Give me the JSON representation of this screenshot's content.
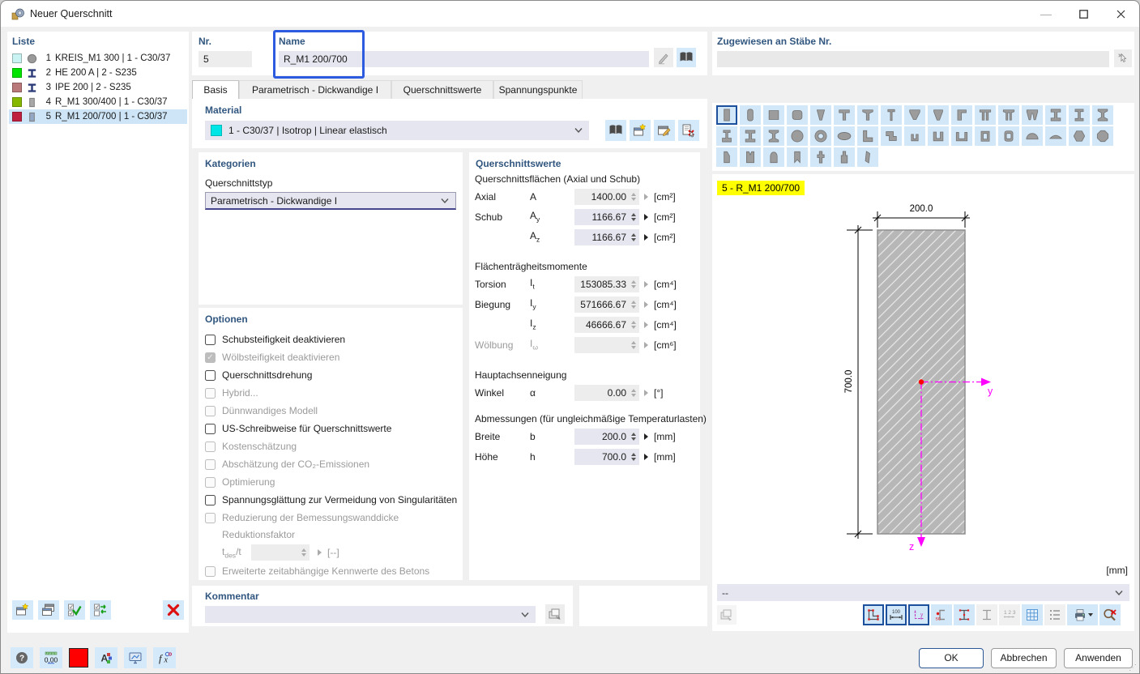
{
  "window": {
    "title": "Neuer Querschnitt"
  },
  "liste": {
    "header": "Liste",
    "items": [
      {
        "nr": "1",
        "label": "KREIS_M1 300 | 1 - C30/37",
        "color": "#c9f2f2",
        "shape": "circle",
        "shape_color": "#9a9a9a",
        "selected": false
      },
      {
        "nr": "2",
        "label": "HE 200 A | 2 - S235",
        "color": "#00e400",
        "shape": "ibeam",
        "shape_color": "#2a3a77",
        "selected": false
      },
      {
        "nr": "3",
        "label": "IPE 200 | 2 - S235",
        "color": "#b9797a",
        "shape": "ibeam",
        "shape_color": "#2a3a77",
        "selected": false
      },
      {
        "nr": "4",
        "label": "R_M1 300/400 | 1 - C30/37",
        "color": "#86b800",
        "shape": "rect",
        "shape_color": "#a8a8a8",
        "selected": false
      },
      {
        "nr": "5",
        "label": "R_M1 200/700 | 1 - C30/37",
        "color": "#c0203f",
        "shape": "rect",
        "shape_color": "#93a7c4",
        "selected": true
      }
    ],
    "toolbar": [
      {
        "name": "new-section",
        "glyph": "newwin"
      },
      {
        "name": "copy-section",
        "glyph": "copywin"
      },
      {
        "name": "select-all-checks",
        "glyph": "checkall"
      },
      {
        "name": "invert-checks",
        "glyph": "invert"
      },
      {
        "name": "delete-section",
        "glyph": "delx",
        "push": true
      }
    ]
  },
  "header_fields": {
    "nr_label": "Nr.",
    "nr_value": "5",
    "name_label": "Name",
    "name_value": "R_M1 200/700"
  },
  "assigned": {
    "label": "Zugewiesen an Stäbe Nr.",
    "value": ""
  },
  "tabs": [
    {
      "label": "Basis",
      "active": true
    },
    {
      "label": "Parametrisch - Dickwandige I",
      "active": false
    },
    {
      "label": "Querschnittswerte",
      "active": false
    },
    {
      "label": "Spannungspunkte",
      "active": false
    }
  ],
  "material": {
    "header": "Material",
    "value": "1 - C30/37 | Isotrop | Linear elastisch",
    "swatch_color": "#00e6e6",
    "icons": [
      {
        "name": "material-library",
        "glyph": "book"
      },
      {
        "name": "material-new",
        "glyph": "newwin"
      },
      {
        "name": "material-edit",
        "glyph": "editwin"
      },
      {
        "name": "material-delete",
        "glyph": "deldoc"
      }
    ]
  },
  "kategorien": {
    "header": "Kategorien",
    "type_label": "Querschnittstyp",
    "type_value": "Parametrisch - Dickwandige I"
  },
  "optionen": {
    "header": "Optionen",
    "items": [
      {
        "id": "schubsteifigkeit",
        "label": "Schubsteifigkeit deaktivieren",
        "checked": false,
        "disabled": false
      },
      {
        "id": "woelbsteifigkeit",
        "label": "Wölbsteifigkeit deaktivieren",
        "checked": true,
        "disabled": true
      },
      {
        "id": "querschnittsdrehung",
        "label": "Querschnittsdrehung",
        "checked": false,
        "disabled": false
      },
      {
        "id": "hybrid",
        "label": "Hybrid...",
        "checked": false,
        "disabled": true
      },
      {
        "id": "duennwandiges-modell",
        "label": "Dünnwandiges Modell",
        "checked": false,
        "disabled": true
      },
      {
        "id": "us-schreibweise",
        "label": "US-Schreibweise für Querschnittswerte",
        "checked": false,
        "disabled": false
      },
      {
        "id": "kostenschaetzung",
        "label": "Kostenschätzung",
        "checked": false,
        "disabled": true
      },
      {
        "id": "co2-emissionen",
        "label": "Abschätzung der CO₂-Emissionen",
        "checked": false,
        "disabled": true
      },
      {
        "id": "optimierung",
        "label": "Optimierung",
        "checked": false,
        "disabled": true
      },
      {
        "id": "spannungsglaettung",
        "label": "Spannungsglättung zur Vermeidung von Singularitäten",
        "checked": false,
        "disabled": false
      },
      {
        "id": "reduzierung-wanddicke",
        "label": "Reduzierung der Bemessungswanddicke",
        "checked": false,
        "disabled": true
      },
      {
        "id": "erweiterte-kennwerte",
        "label": "Erweiterte zeitabhängige Kennwerte des Betons",
        "checked": false,
        "disabled": true
      }
    ],
    "reduktion": {
      "label": "Reduktionsfaktor",
      "sym": "t",
      "sym_sub": "des",
      "sym_rest": "/t",
      "value": "",
      "unit": "[--]"
    }
  },
  "werte": {
    "header": "Querschnittswerte",
    "groups": [
      {
        "title": "Querschnittsflächen (Axial und Schub)",
        "rows": [
          {
            "label": "Axial",
            "sym": "A",
            "sub": "",
            "value": "1400.00",
            "unit": "[cm²]",
            "enabled": false,
            "muted": false
          },
          {
            "label": "Schub",
            "sym": "A",
            "sub": "y",
            "value": "1166.67",
            "unit": "[cm²]",
            "enabled": true,
            "muted": false
          },
          {
            "label": "",
            "sym": "A",
            "sub": "z",
            "value": "1166.67",
            "unit": "[cm²]",
            "enabled": true,
            "muted": false
          }
        ]
      },
      {
        "title": "Flächenträgheitsmomente",
        "rows": [
          {
            "label": "Torsion",
            "sym": "I",
            "sub": "t",
            "value": "153085.33",
            "unit": "[cm⁴]",
            "enabled": false,
            "muted": false
          },
          {
            "label": "Biegung",
            "sym": "I",
            "sub": "y",
            "value": "571666.67",
            "unit": "[cm⁴]",
            "enabled": false,
            "muted": false
          },
          {
            "label": "",
            "sym": "I",
            "sub": "z",
            "value": "46666.67",
            "unit": "[cm⁴]",
            "enabled": false,
            "muted": false
          },
          {
            "label": "Wölbung",
            "sym": "I",
            "sub": "ω",
            "value": "",
            "unit": "[cm⁶]",
            "enabled": false,
            "muted": true
          }
        ]
      },
      {
        "title": "Hauptachsenneigung",
        "rows": [
          {
            "label": "Winkel",
            "sym": "α",
            "sub": "",
            "value": "0.00",
            "unit": "[°]",
            "enabled": false,
            "muted": false
          }
        ]
      },
      {
        "title": "Abmessungen (für ungleichmäßige Temperaturlasten)",
        "rows": [
          {
            "label": "Breite",
            "sym": "b",
            "sub": "",
            "value": "200.0",
            "unit": "[mm]",
            "enabled": true,
            "muted": false
          },
          {
            "label": "Höhe",
            "sym": "h",
            "sub": "",
            "value": "700.0",
            "unit": "[mm]",
            "enabled": true,
            "muted": false
          }
        ]
      }
    ]
  },
  "kommentar": {
    "header": "Kommentar",
    "value": ""
  },
  "shape_grid": {
    "rows": [
      [
        {
          "name": "rectangle",
          "glyph": "rect",
          "selected": true
        },
        {
          "name": "rounded-rectangle",
          "glyph": "rrect"
        },
        {
          "name": "square",
          "glyph": "square"
        },
        {
          "name": "rounded-square",
          "glyph": "rsquare"
        },
        {
          "name": "wedge",
          "glyph": "wedge"
        },
        {
          "name": "t-section",
          "glyph": "tee"
        },
        {
          "name": "t-section-tapered",
          "glyph": "tee2"
        },
        {
          "name": "t-section-slim",
          "glyph": "tee3"
        },
        {
          "name": "t-section-v",
          "glyph": "vflange"
        },
        {
          "name": "t-section-v-narrow",
          "glyph": "vflange2"
        },
        {
          "name": "l-step",
          "glyph": "gamma"
        },
        {
          "name": "double-t",
          "glyph": "pi"
        },
        {
          "name": "double-t-tapered",
          "glyph": "pi2"
        },
        {
          "name": "double-wedge",
          "glyph": "ww"
        },
        {
          "name": "i-section",
          "glyph": "ibeam"
        },
        {
          "name": "i-section-narrow",
          "glyph": "ibeam2"
        },
        {
          "name": "i-section-tapered",
          "glyph": "itaper"
        }
      ],
      [
        {
          "name": "i-section-unsymmetric",
          "glyph": "ibeamB"
        },
        {
          "name": "i-section-heavy",
          "glyph": "ibeam"
        },
        {
          "name": "i-section-haunched",
          "glyph": "itaper"
        },
        {
          "name": "circle",
          "glyph": "circle"
        },
        {
          "name": "ring",
          "glyph": "ring"
        },
        {
          "name": "ellipse",
          "glyph": "ellipse"
        },
        {
          "name": "angle",
          "glyph": "angle"
        },
        {
          "name": "z-section",
          "glyph": "zee"
        },
        {
          "name": "channel-small",
          "glyph": "chan1"
        },
        {
          "name": "channel",
          "glyph": "chan"
        },
        {
          "name": "channel-wide",
          "glyph": "chanw"
        },
        {
          "name": "box",
          "glyph": "box"
        },
        {
          "name": "rounded-box",
          "glyph": "obox"
        },
        {
          "name": "semicircle",
          "glyph": "semi"
        },
        {
          "name": "circular-segment",
          "glyph": "segment"
        },
        {
          "name": "hexagon",
          "glyph": "hex"
        },
        {
          "name": "octagon",
          "glyph": "oct"
        }
      ],
      [
        {
          "name": "cut-rectangle",
          "glyph": "cut"
        },
        {
          "name": "notched-rectangle",
          "glyph": "notch"
        },
        {
          "name": "arched-rectangle",
          "glyph": "arch"
        },
        {
          "name": "banner",
          "glyph": "banner"
        },
        {
          "name": "cruciform",
          "glyph": "cross"
        },
        {
          "name": "stem",
          "glyph": "stem"
        },
        {
          "name": "sliver",
          "glyph": "sliver"
        }
      ]
    ]
  },
  "drawing": {
    "badge": "5 - R_M1 200/700",
    "dim_width": "200.0",
    "dim_height": "700.0",
    "axis_y": "y",
    "axis_z": "z",
    "unit": "[mm]",
    "combo_value": "--",
    "toolbar": [
      {
        "name": "show-points",
        "glyph": "points",
        "state": "pressed"
      },
      {
        "name": "show-dimensions",
        "glyph": "dim",
        "state": "pressed"
      },
      {
        "name": "show-axes",
        "glyph": "axes",
        "state": "pressed"
      },
      {
        "name": "show-shear-center",
        "glyph": "sc",
        "state": "normal"
      },
      {
        "name": "show-stress-points",
        "glyph": "stress",
        "state": "normal"
      },
      {
        "name": "show-section-outline",
        "glyph": "outline",
        "state": "disabled"
      },
      {
        "name": "show-numbering",
        "glyph": "num",
        "state": "disabled"
      },
      {
        "name": "show-grid",
        "glyph": "grid",
        "state": "normal"
      },
      {
        "name": "show-details",
        "glyph": "details",
        "state": "disabled"
      },
      {
        "name": "print",
        "glyph": "print",
        "state": "normal",
        "caret": true
      },
      {
        "name": "zoom-reset",
        "glyph": "zoomx",
        "state": "normal"
      }
    ]
  },
  "footer": {
    "icons": [
      {
        "name": "help",
        "glyph": "help"
      },
      {
        "name": "units",
        "glyph": "units"
      },
      {
        "name": "section-color",
        "glyph": "color"
      },
      {
        "name": "display-settings",
        "glyph": "disp"
      },
      {
        "name": "screen-view",
        "glyph": "screen"
      },
      {
        "name": "formula",
        "glyph": "fx"
      }
    ],
    "ok": "OK",
    "cancel": "Abbrechen",
    "apply": "Anwenden"
  },
  "colors": {
    "accent": "#2b5797",
    "selection": "#cde5f7",
    "icon_bg": "#d2e7f8",
    "input_enabled": "#e6e6f0",
    "input_disabled": "#ededed",
    "annotation_blue": "#2d5be0",
    "badge_yellow": "#ffff00",
    "axis_magenta": "#ff00ff",
    "centroid_red": "#ff0000",
    "current_color": "#ff0000"
  }
}
